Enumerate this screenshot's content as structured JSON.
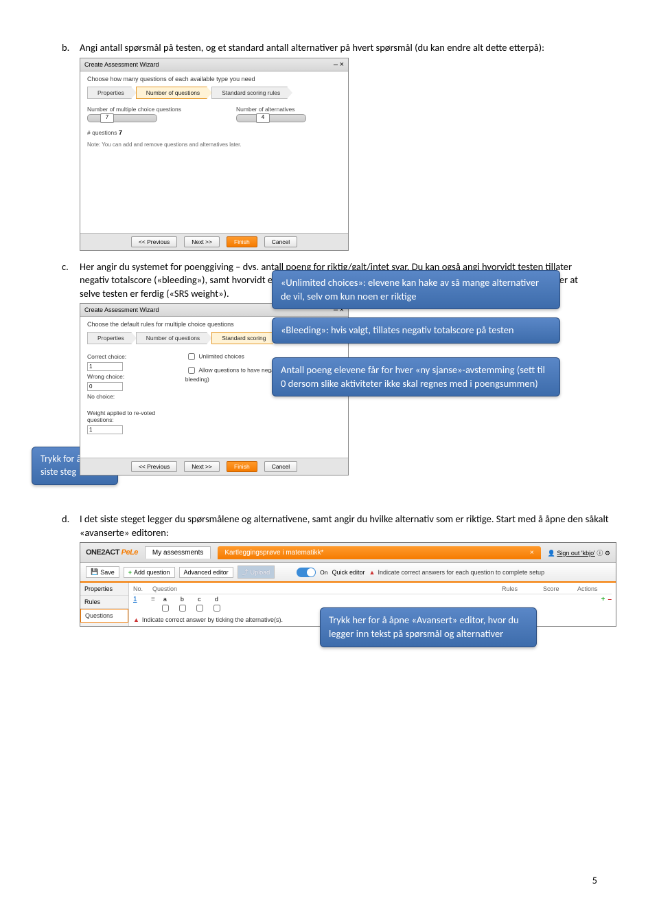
{
  "listB": {
    "marker": "b.",
    "text": "Angi antall spørsmål på testen, og et standard antall alternativer på hvert spørsmål (du kan endre alt dette etterpå):"
  },
  "wizard1": {
    "title": "Create Assessment Wizard",
    "subtitle": "Choose how many questions of each available type you need",
    "chev1": "Properties",
    "chev2": "Number of questions",
    "chev3": "Standard scoring rules",
    "mcq_label": "Number of multiple choice questions",
    "mcq_value": "7",
    "alt_label": "Number of alternatives",
    "alt_value": "4",
    "count_label": "# questions",
    "count_value": "7",
    "note": "Note: You can add and remove questions and alternatives later.",
    "prev": "<< Previous",
    "next": "Next >>",
    "finish": "Finish",
    "cancel": "Cancel"
  },
  "listC": {
    "marker": "c.",
    "text": "Her angir du systemet for poenggiving – dvs. antall poeng for riktig/galt/intet svar. Du kan også angi hvorvidt testen tillater negativ totalscore («bleeding»), samt hvorvidt elevene skal få poenguttelling for å delta i «ny-sjanse»-avstemminger etter at selve testen er ferdig («SRS weight»)."
  },
  "wizard2": {
    "title": "Create Assessment Wizard",
    "subtitle": "Choose the default rules for multiple choice questions",
    "chev1": "Properties",
    "chev2": "Number of questions",
    "chev3": "Standard scoring",
    "correct_label": "Correct choice:",
    "correct_value": "1",
    "wrong_label": "Wrong choice:",
    "wrong_value": "0",
    "nochoice_label": "No choice:",
    "weight_label": "Weight applied to re-voted questions:",
    "weight_value": "1",
    "unlimited": "Unlimited choices",
    "allow_neg": "Allow questions to have negative score (Allow bleeding)",
    "prev": "<< Previous",
    "next": "Next >>",
    "finish": "Finish",
    "cancel": "Cancel"
  },
  "callouts": {
    "unlimited": "«Unlimited choices»: elevene kan hake av så mange alternativer de vil, selv om kun noen er riktige",
    "bleeding": "«Bleeding»: hvis valgt, tillates negativ totalscore på testen",
    "weight": "Antall poeng elevene får for hver «ny sjanse»-avstemming (sett til 0 dersom slike aktiviteter ikke skal regnes med i poengsummen)",
    "last_step": "Trykk for å gå til siste steg",
    "advanced": "Trykk her for å åpne «Avansert» editor, hvor du legger inn tekst på spørsmål og alternativer"
  },
  "listD": {
    "marker": "d.",
    "text": "I det siste steget legger du spørsmålene og alternativene, samt angir du hvilke alternativ som er riktige. Start med å åpne den såkalt «avanserte» editoren:"
  },
  "editor": {
    "brand1": "ONE2ACT",
    "brand2": "PeLe",
    "my_assessments": "My assessments",
    "tab_title": "Kartleggingsprøve i matematikk*",
    "signout": "Sign out 'kbjo'",
    "save": "Save",
    "addq": "Add question",
    "adv": "Advanced editor",
    "upload": "Upload",
    "on": "On",
    "quick": "Quick editor",
    "warn": "Indicate correct answers for each question to complete setup",
    "side_properties": "Properties",
    "side_rules": "Rules",
    "side_questions": "Questions",
    "col_no": "No.",
    "col_q": "Question",
    "col_rules": "Rules",
    "col_score": "Score",
    "col_actions": "Actions",
    "q1": "1",
    "alt_a": "a",
    "alt_b": "b",
    "alt_c": "c",
    "alt_d": "d",
    "tick_note": "Indicate correct answer by ticking the alternative(s)."
  },
  "page_number": "5"
}
